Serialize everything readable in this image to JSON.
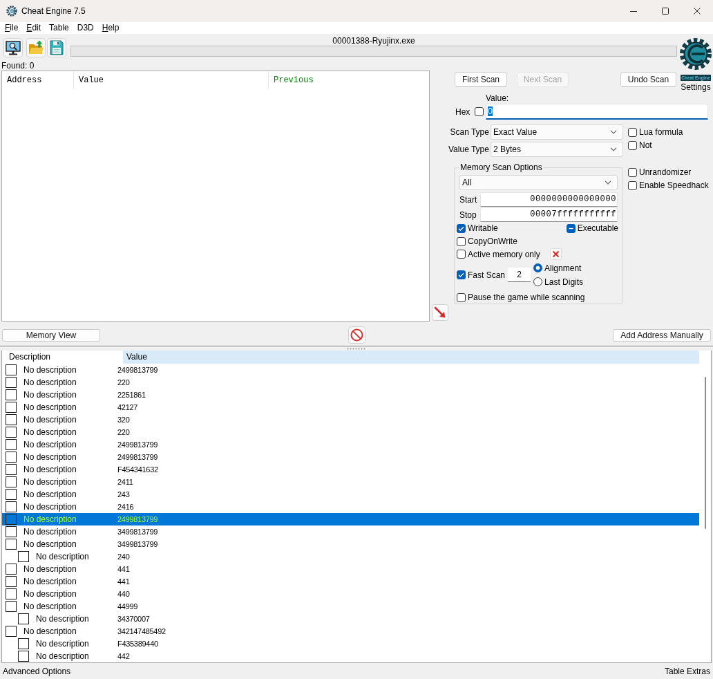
{
  "window": {
    "title": "Cheat Engine 7.5"
  },
  "menu": [
    {
      "label": "File",
      "mnemonic": true
    },
    {
      "label": "Edit",
      "mnemonic": true
    },
    {
      "label": "Table",
      "mnemonic": false
    },
    {
      "label": "D3D",
      "mnemonic": false
    },
    {
      "label": "Help",
      "mnemonic": true
    }
  ],
  "toolbar": {
    "process": "00001388-Ryujinx.exe",
    "progress": {
      "level": 0
    },
    "logo_caption": "Cheat Engine",
    "settings_label": "Settings"
  },
  "found": "Found: 0",
  "results": {
    "columns": [
      {
        "label": "Address",
        "color": "#000000"
      },
      {
        "label": "Value",
        "color": "#000000"
      },
      {
        "label": "Previous",
        "color": "#008000"
      }
    ]
  },
  "scan": {
    "buttons": [
      {
        "label": "First Scan",
        "disabled": false
      },
      {
        "label": "Next Scan",
        "disabled": true
      },
      {
        "label": "Undo Scan",
        "disabled": false
      }
    ],
    "value_label": "Value:",
    "hex": {
      "label": "Hex",
      "checked": false
    },
    "value": "0",
    "value_selected": true,
    "scan_type": {
      "label": "Scan Type",
      "value": "Exact Value"
    },
    "value_type": {
      "label": "Value Type",
      "value": "2 Bytes"
    },
    "side_options": [
      {
        "label": "Lua formula",
        "checked": false
      },
      {
        "label": "Not",
        "checked": false
      }
    ],
    "memory": {
      "title": "Memory Scan Options",
      "region": "All",
      "start": {
        "label": "Start",
        "value": "0000000000000000"
      },
      "stop": {
        "label": "Stop",
        "value": "00007fffffffffff"
      },
      "flags": [
        {
          "label": "Writable",
          "checked": true,
          "indeterminate": false
        },
        {
          "label": "Executable",
          "checked": false,
          "indeterminate": true
        },
        {
          "label": "CopyOnWrite",
          "checked": false,
          "indeterminate": false
        },
        {
          "label": "Active memory only",
          "checked": false,
          "indeterminate": false
        }
      ],
      "fast_scan": {
        "label": "Fast Scan",
        "checked": true,
        "value": "2"
      },
      "alignment": [
        {
          "label": "Alignment",
          "selected": true
        },
        {
          "label": "Last Digits",
          "selected": false
        }
      ],
      "pause": {
        "label": "Pause the game while scanning",
        "checked": false
      }
    },
    "extra_options": [
      {
        "label": "Unrandomizer",
        "checked": false
      },
      {
        "label": "Enable Speedhack",
        "checked": false
      }
    ]
  },
  "actions": {
    "memory_view": "Memory View",
    "add_address": "Add Address Manually"
  },
  "address_table": {
    "columns": [
      {
        "label": "Description",
        "selected": false
      },
      {
        "label": "Value",
        "selected": true
      }
    ],
    "rows": [
      {
        "description": "No description",
        "value": "2499813799",
        "checked": false,
        "selected": false
      },
      {
        "description": "No description",
        "value": "220",
        "checked": false,
        "selected": false
      },
      {
        "description": "No description",
        "value": "2251861",
        "checked": false,
        "selected": false
      },
      {
        "description": "No description",
        "value": "42127",
        "checked": false,
        "selected": false
      },
      {
        "description": "No description",
        "value": "320",
        "checked": false,
        "selected": false
      },
      {
        "description": "No description",
        "value": "220",
        "checked": false,
        "selected": false
      },
      {
        "description": "No description",
        "value": "2499813799",
        "checked": false,
        "selected": false
      },
      {
        "description": "No description",
        "value": "2499813799",
        "checked": false,
        "selected": false
      },
      {
        "description": "No description",
        "value": "F454341632",
        "checked": false,
        "selected": false
      },
      {
        "description": "No description",
        "value": "2411",
        "checked": false,
        "selected": false
      },
      {
        "description": "No description",
        "value": "243",
        "checked": false,
        "selected": false
      },
      {
        "description": "No description",
        "value": "2416",
        "checked": false,
        "selected": false
      },
      {
        "description": "No description",
        "value": "2499813799",
        "checked": false,
        "selected": true
      },
      {
        "description": "No description",
        "value": "3499813799",
        "checked": false,
        "selected": false
      },
      {
        "description": "No description",
        "value": "3499813799",
        "checked": false,
        "selected": false,
        "children": [
          {
            "description": "No description",
            "value": "240",
            "checked": false,
            "selected": false
          }
        ]
      },
      {
        "description": "No description",
        "value": "441",
        "checked": false,
        "selected": false
      },
      {
        "description": "No description",
        "value": "441",
        "checked": false,
        "selected": false
      },
      {
        "description": "No description",
        "value": "440",
        "checked": false,
        "selected": false
      },
      {
        "description": "No description",
        "value": "44999",
        "checked": false,
        "selected": false,
        "children": [
          {
            "description": "No description",
            "value": "34370007",
            "checked": false,
            "selected": false
          }
        ]
      },
      {
        "description": "No description",
        "value": "342147485492",
        "checked": false,
        "selected": false,
        "children": [
          {
            "description": "No description",
            "value": "F435389440",
            "checked": false,
            "selected": false
          },
          {
            "description": "No description",
            "value": "442",
            "checked": false,
            "selected": false
          }
        ]
      }
    ]
  },
  "status_bar": {
    "left": "Advanced Options",
    "right": "Table Extras"
  }
}
